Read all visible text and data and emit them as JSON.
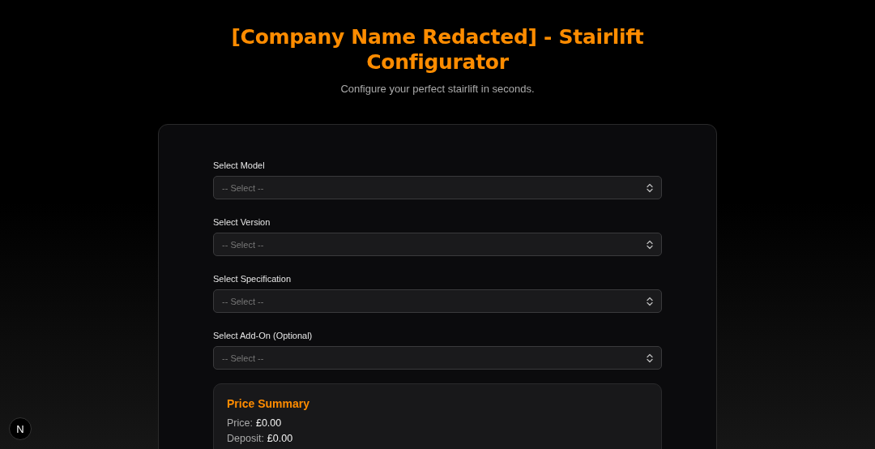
{
  "header": {
    "title": "[Company Name Redacted] - Stairlift Configurator",
    "subtitle": "Configure your perfect stairlift in seconds."
  },
  "fields": [
    {
      "label": "Select Model",
      "placeholder": "-- Select --"
    },
    {
      "label": "Select Version",
      "placeholder": "-- Select --"
    },
    {
      "label": "Select Specification",
      "placeholder": "-- Select --"
    },
    {
      "label": "Select Add-On (Optional)",
      "placeholder": "-- Select --"
    }
  ],
  "price_summary": {
    "title": "Price Summary",
    "lines": [
      {
        "label": "Price:",
        "value": "£0.00"
      },
      {
        "label": "Deposit:",
        "value": "£0.00"
      }
    ]
  },
  "dev_badge": {
    "letter": "N"
  }
}
